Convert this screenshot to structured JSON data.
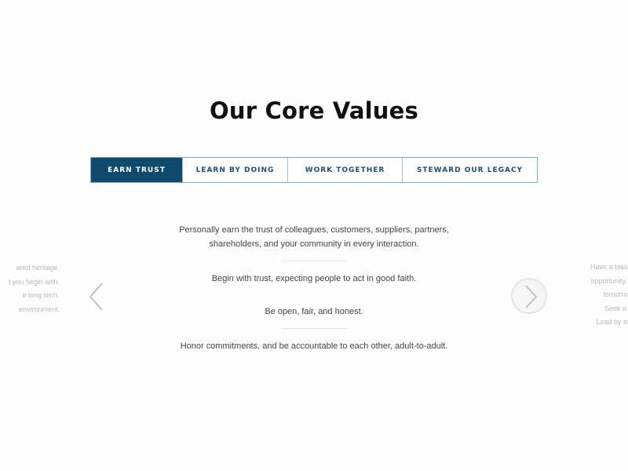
{
  "page": {
    "title": "Our Core Values"
  },
  "tabs": [
    {
      "label": "EARN TRUST",
      "active": true
    },
    {
      "label": "LEARN BY DOING",
      "active": false
    },
    {
      "label": "WORK TOGETHER",
      "active": false
    },
    {
      "label": "STEWARD OUR LEGACY",
      "active": false
    }
  ],
  "colors": {
    "accent": "#0d4a6e",
    "tab_text": "#1f4e6e",
    "tab_border": "#8aa4b8",
    "body_text": "#444444",
    "faded_text": "#b8b8b8"
  },
  "carousel": {
    "current_slide": {
      "statements": [
        {
          "line1": "Personally earn the trust of colleagues, customers, suppliers, partners,",
          "line2": "shareholders, and your community in every interaction."
        },
        {
          "line1": "Begin with trust, expecting people to act in good faith."
        },
        {
          "line1": "Be open, fair, and honest."
        },
        {
          "line1": "Honor commitments, and be accountable to each other, adult-to-adult."
        }
      ]
    },
    "previous_slide_peek": {
      "lines": [
        "ared heritage.",
        "t you begin with.",
        "e long term.",
        "environment."
      ]
    },
    "next_slide_peek": {
      "lines": [
        "Have a bias tow",
        "opportunity. Get",
        "tomorro",
        "Seek o",
        "Lead by exa"
      ]
    },
    "prev_icon": "chevron-left-icon",
    "next_icon": "chevron-right-circle-icon"
  }
}
